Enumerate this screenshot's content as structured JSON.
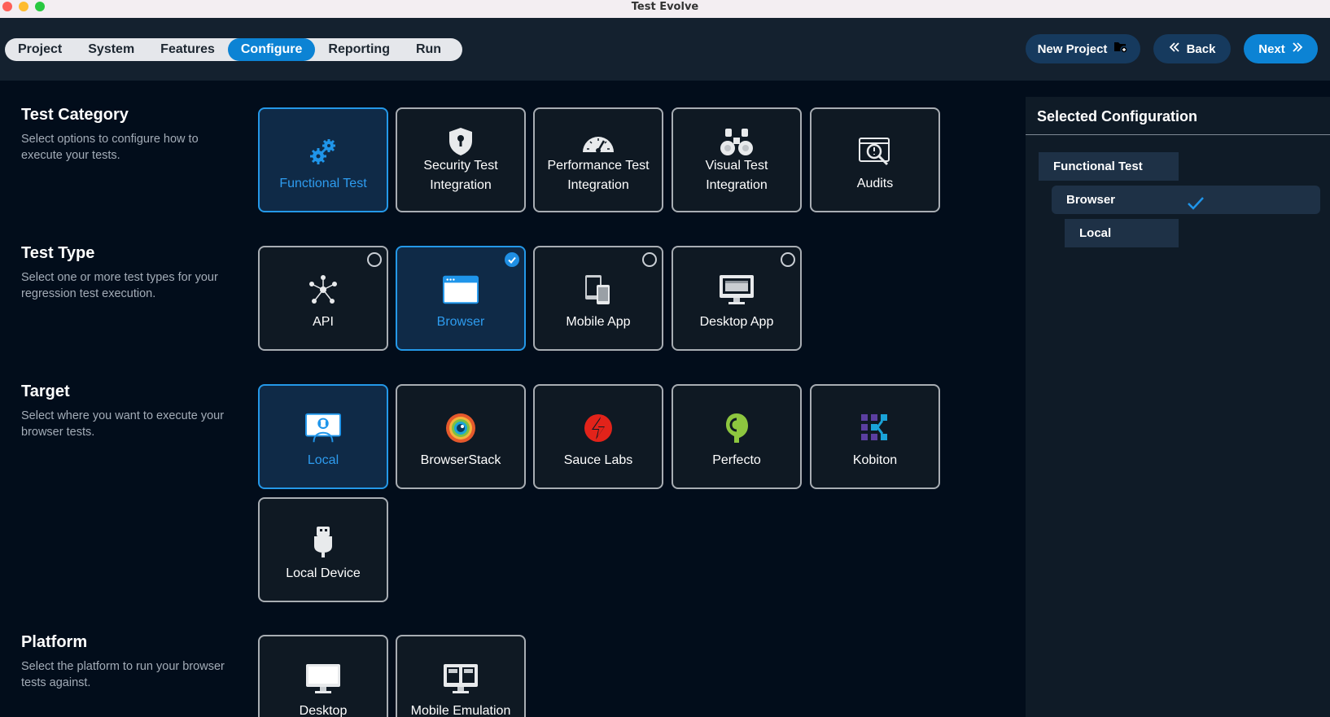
{
  "window": {
    "title": "Test Evolve"
  },
  "tabs": [
    {
      "label": "Project",
      "active": false
    },
    {
      "label": "System",
      "active": false
    },
    {
      "label": "Features",
      "active": false
    },
    {
      "label": "Configure",
      "active": true
    },
    {
      "label": "Reporting",
      "active": false
    },
    {
      "label": "Run",
      "active": false
    }
  ],
  "actions": {
    "new_project": "New Project",
    "back": "Back",
    "next": "Next"
  },
  "sections": {
    "test_category": {
      "heading": "Test Category",
      "description": "Select options to configure how to execute your tests.",
      "tiles": [
        {
          "label": "Functional Test",
          "icon": "gears-icon",
          "selected": true
        },
        {
          "label": "Security Test Integration",
          "icon": "shield-lock-icon",
          "selected": false
        },
        {
          "label": "Performance Test Integration",
          "icon": "speedometer-icon",
          "selected": false
        },
        {
          "label": "Visual Test Integration",
          "icon": "binoculars-icon",
          "selected": false
        },
        {
          "label": "Audits",
          "icon": "audit-magnifier-icon",
          "selected": false
        }
      ]
    },
    "test_type": {
      "heading": "Test Type",
      "description": "Select one or more test types for your regression test execution.",
      "tiles": [
        {
          "label": "API",
          "icon": "network-nodes-icon",
          "selected": false
        },
        {
          "label": "Browser",
          "icon": "browser-window-icon",
          "selected": true
        },
        {
          "label": "Mobile App",
          "icon": "mobile-devices-icon",
          "selected": false
        },
        {
          "label": "Desktop App",
          "icon": "desktop-monitor-icon",
          "selected": false
        }
      ]
    },
    "target": {
      "heading": "Target",
      "description": "Select where you want to execute your browser tests.",
      "tiles": [
        {
          "label": "Local",
          "icon": "local-user-screen-icon",
          "selected": true
        },
        {
          "label": "BrowserStack",
          "icon": "browserstack-logo-icon",
          "selected": false
        },
        {
          "label": "Sauce Labs",
          "icon": "saucelabs-logo-icon",
          "selected": false
        },
        {
          "label": "Perfecto",
          "icon": "perfecto-logo-icon",
          "selected": false
        },
        {
          "label": "Kobiton",
          "icon": "kobiton-logo-icon",
          "selected": false
        },
        {
          "label": "Local Device",
          "icon": "usb-plug-icon",
          "selected": false
        }
      ]
    },
    "platform": {
      "heading": "Platform",
      "description": "Select the platform to run your browser tests against.",
      "tiles": [
        {
          "label": "Desktop",
          "icon": "desktop-monitor-icon",
          "selected": false
        },
        {
          "label": "Mobile Emulation",
          "icon": "mobile-emulation-icon",
          "selected": false
        }
      ]
    }
  },
  "selected_configuration": {
    "title": "Selected Configuration",
    "items": [
      "Functional Test",
      "Browser",
      "Local"
    ]
  },
  "colors": {
    "accent": "#0c83d4",
    "selected_border": "#2498e8",
    "tile_border": "#a8adb3"
  }
}
